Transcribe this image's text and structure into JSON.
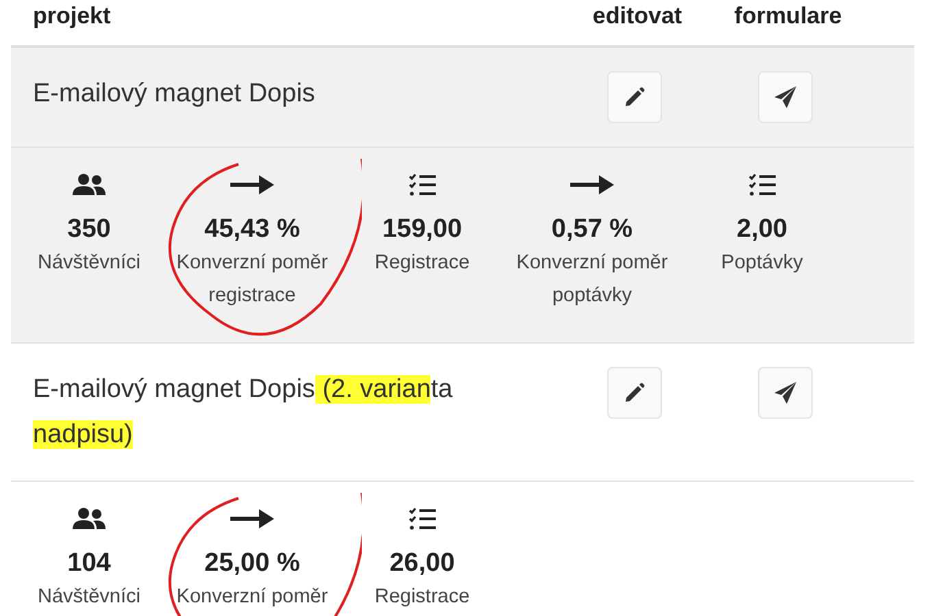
{
  "table": {
    "columns": [
      "projekt",
      "editovat",
      "formulare"
    ],
    "projects": [
      {
        "title": [
          {
            "text": "E-mailový magnet Dopis",
            "highlight": false
          }
        ],
        "shaded": true,
        "metrics": [
          {
            "kind": "people",
            "value": "350",
            "label": "Návštěvníci",
            "circled": false
          },
          {
            "kind": "rate",
            "value": "45,43 %",
            "label": "Konverzní poměr registrace",
            "circled": true
          },
          {
            "kind": "list",
            "value": "159,00",
            "label": "Registrace",
            "circled": false
          },
          {
            "kind": "rate",
            "value": "0,57 %",
            "label": "Konverzní poměr poptávky",
            "circled": false
          },
          {
            "kind": "list",
            "value": "2,00",
            "label": "Poptávky",
            "circled": false
          }
        ]
      },
      {
        "title": [
          {
            "text": "E-mailový magnet Dopis",
            "highlight": false
          },
          {
            "text": " (2. varian",
            "highlight": true
          },
          {
            "text": "ta ",
            "highlight": false
          },
          {
            "text": "nadpisu)",
            "highlight": true
          }
        ],
        "shaded": false,
        "metrics": [
          {
            "kind": "people",
            "value": "104",
            "label": "Návštěvníci",
            "circled": false
          },
          {
            "kind": "rate",
            "value": "25,00 %",
            "label": "Konverzní poměr",
            "circled": true
          },
          {
            "kind": "list",
            "value": "26,00",
            "label": "Registrace",
            "circled": false
          }
        ]
      }
    ]
  }
}
